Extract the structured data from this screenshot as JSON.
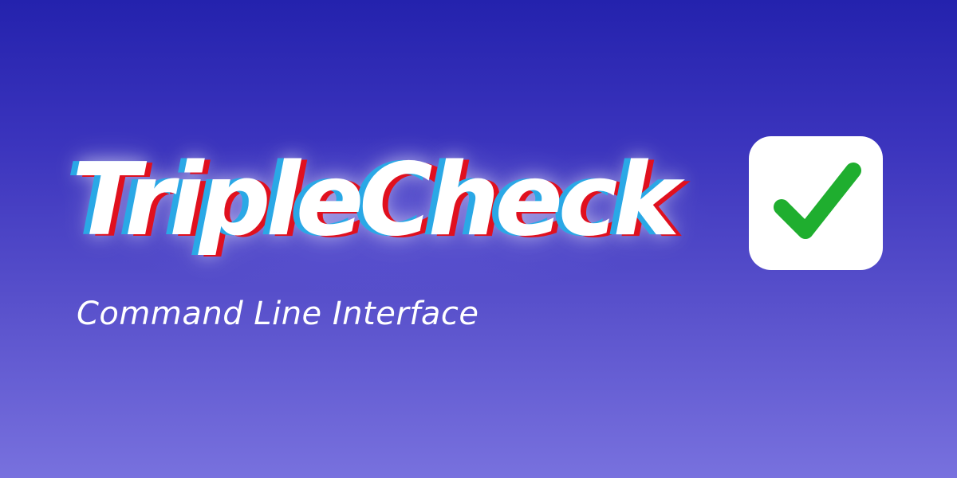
{
  "title": "TripleCheck",
  "subtitle": "Command Line Interface",
  "icons": {
    "badge": "checkmark-icon"
  },
  "colors": {
    "background_top": "#2422ad",
    "background_bottom": "#7871de",
    "title_text": "#ffffff",
    "title_shadow_cyan": "#2aa8e6",
    "title_shadow_red": "#e0101e",
    "check_green": "#1fae2f",
    "badge_background": "#ffffff"
  }
}
